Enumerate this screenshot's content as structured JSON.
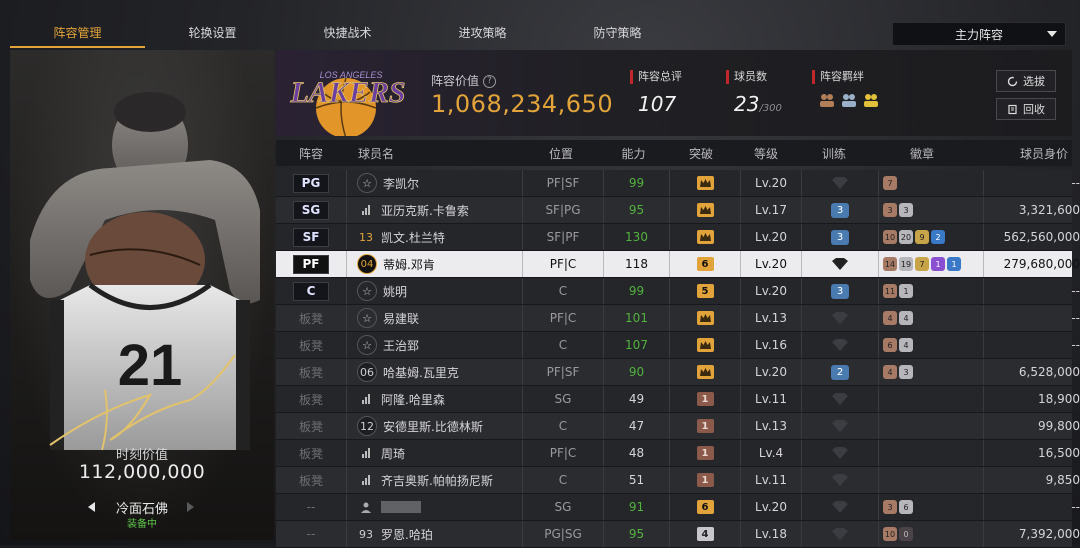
{
  "tabs": [
    {
      "label": "阵容管理",
      "active": true
    },
    {
      "label": "轮换设置",
      "active": false
    },
    {
      "label": "快捷战术",
      "active": false
    },
    {
      "label": "进攻策略",
      "active": false
    },
    {
      "label": "防守策略",
      "active": false
    }
  ],
  "lineup_select": "主力阵容",
  "card": {
    "jersey_number": "21",
    "value_label": "时刻价值",
    "value": "112,000,000",
    "name": "冷面石佛",
    "status": "装备中"
  },
  "header": {
    "team_logo_text": "LAKERS",
    "team_logo_small": "LOS ANGELES",
    "value_label": "阵容价值",
    "value": "1,068,234,650",
    "rating_label": "阵容总评",
    "rating": "107",
    "count_label": "球员数",
    "count": "23",
    "count_max": "/300",
    "bond_label": "阵容羁绊",
    "select_label": "选拔",
    "recycle_label": "回收"
  },
  "columns": {
    "pos": "阵容",
    "name": "球员名",
    "position": "位置",
    "ability": "能力",
    "breakthrough": "突破",
    "level": "等级",
    "training": "训练",
    "badges": "徽章",
    "value": "球员身价"
  },
  "rows": [
    {
      "slot": "PG",
      "icon": "☆",
      "icon_type": "star",
      "name": "李凯尔",
      "position": "PF|SF",
      "ability": "99",
      "ability_green": true,
      "brk": "crown",
      "level": "Lv.20",
      "train": "",
      "badges": [
        {
          "t": "bronze",
          "v": "7"
        }
      ],
      "value": "--"
    },
    {
      "slot": "SG",
      "icon": "bar",
      "icon_type": "bar",
      "name": "亚历克斯.卡鲁索",
      "position": "SF|PG",
      "ability": "95",
      "ability_green": true,
      "brk": "crown",
      "level": "Lv.17",
      "train": "3",
      "badges": [
        {
          "t": "bronze",
          "v": "3"
        },
        {
          "t": "silver",
          "v": "3"
        }
      ],
      "value": "3,321,600"
    },
    {
      "slot": "SF",
      "icon": "13",
      "icon_type": "gold",
      "name": "凯文.杜兰特",
      "position": "SF|PF",
      "ability": "130",
      "ability_green": true,
      "brk": "crown",
      "level": "Lv.20",
      "train": "3",
      "badges": [
        {
          "t": "bronze",
          "v": "10"
        },
        {
          "t": "silver",
          "v": "20"
        },
        {
          "t": "gold",
          "v": "9"
        },
        {
          "t": "blue",
          "v": "2"
        }
      ],
      "value": "562,560,000"
    },
    {
      "slot": "PF",
      "icon": "04",
      "icon_type": "sel",
      "name": "蒂姆.邓肯",
      "position": "PF|C",
      "ability": "118",
      "ability_green": false,
      "brk": "6",
      "level": "Lv.20",
      "train": "",
      "badges": [
        {
          "t": "bronze",
          "v": "14"
        },
        {
          "t": "silver",
          "v": "19"
        },
        {
          "t": "gold",
          "v": "7"
        },
        {
          "t": "purple",
          "v": "1"
        },
        {
          "t": "blue",
          "v": "1"
        }
      ],
      "value": "279,680,000",
      "selected": true
    },
    {
      "slot": "C",
      "icon": "☆",
      "icon_type": "star",
      "name": "姚明",
      "position": "C",
      "ability": "99",
      "ability_green": true,
      "brk": "5",
      "level": "Lv.20",
      "train": "3",
      "badges": [
        {
          "t": "bronze",
          "v": "11"
        },
        {
          "t": "silver",
          "v": "1"
        }
      ],
      "value": "--"
    },
    {
      "slot": "板凳",
      "icon": "☆",
      "icon_type": "star",
      "name": "易建联",
      "position": "PF|C",
      "ability": "101",
      "ability_green": true,
      "brk": "crown",
      "level": "Lv.13",
      "train": "",
      "badges": [
        {
          "t": "bronze",
          "v": "4"
        },
        {
          "t": "silver",
          "v": "4"
        }
      ],
      "value": "--"
    },
    {
      "slot": "板凳",
      "icon": "☆",
      "icon_type": "star",
      "name": "王治郅",
      "position": "C",
      "ability": "107",
      "ability_green": true,
      "brk": "crown",
      "level": "Lv.16",
      "train": "",
      "badges": [
        {
          "t": "bronze",
          "v": "6"
        },
        {
          "t": "silver",
          "v": "4"
        }
      ],
      "value": "--"
    },
    {
      "slot": "板凳",
      "icon": "06",
      "icon_type": "circ",
      "name": "哈基姆.瓦里克",
      "position": "PF|SF",
      "ability": "90",
      "ability_green": true,
      "brk": "crown",
      "level": "Lv.20",
      "train": "2",
      "badges": [
        {
          "t": "bronze",
          "v": "4"
        },
        {
          "t": "silver",
          "v": "3"
        }
      ],
      "value": "6,528,000"
    },
    {
      "slot": "板凳",
      "icon": "bar",
      "icon_type": "bar",
      "name": "阿隆.哈里森",
      "position": "SG",
      "ability": "49",
      "ability_green": false,
      "brk": "1",
      "level": "Lv.11",
      "train": "",
      "badges": [],
      "value": "18,900"
    },
    {
      "slot": "板凳",
      "icon": "12",
      "icon_type": "circ",
      "name": "安德里斯.比德林斯",
      "position": "C",
      "ability": "47",
      "ability_green": false,
      "brk": "1",
      "level": "Lv.13",
      "train": "",
      "badges": [],
      "value": "99,800"
    },
    {
      "slot": "板凳",
      "icon": "bar",
      "icon_type": "bar",
      "name": "周琦",
      "position": "PF|C",
      "ability": "48",
      "ability_green": false,
      "brk": "1",
      "level": "Lv.4",
      "train": "",
      "badges": [],
      "value": "16,500"
    },
    {
      "slot": "板凳",
      "icon": "bar",
      "icon_type": "bar",
      "name": "齐吉奥斯.帕帕扬尼斯",
      "position": "C",
      "ability": "51",
      "ability_green": false,
      "brk": "1",
      "level": "Lv.11",
      "train": "",
      "badges": [],
      "value": "9,850"
    },
    {
      "slot": "--",
      "icon": "user",
      "icon_type": "user",
      "name": "",
      "name_blurred": true,
      "position": "SG",
      "ability": "91",
      "ability_green": true,
      "brk": "6",
      "level": "Lv.20",
      "train": "",
      "badges": [
        {
          "t": "bronze",
          "v": "3"
        },
        {
          "t": "silver",
          "v": "6"
        }
      ],
      "value": "--"
    },
    {
      "slot": "--",
      "icon": "93",
      "icon_type": "plain",
      "name": "罗恩.哈珀",
      "position": "PG|SG",
      "ability": "95",
      "ability_green": true,
      "brk": "4",
      "brk_grey": true,
      "level": "Lv.18",
      "train": "",
      "badges": [
        {
          "t": "bronze",
          "v": "10"
        },
        {
          "t": "dark",
          "v": "0"
        }
      ],
      "value": "7,392,000"
    }
  ],
  "colors": {
    "accent": "#e2a43a",
    "green": "#52b23e",
    "red": "#c0272d",
    "lakers_purple": "#552583"
  }
}
